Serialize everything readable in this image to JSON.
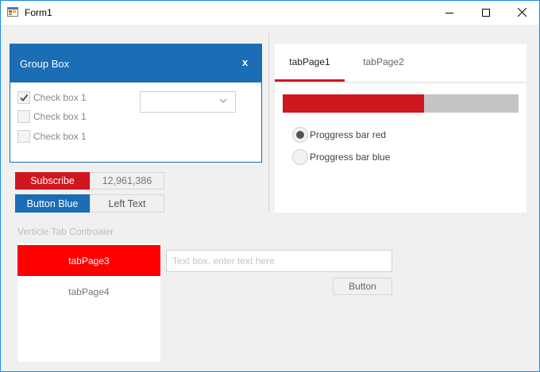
{
  "window": {
    "title": "Form1",
    "icons": {
      "app": "form-app-icon",
      "minimize": "minimize-icon",
      "maximize": "maximize-icon",
      "close": "close-icon"
    }
  },
  "group_box": {
    "title": "Group Box",
    "close_label": "x",
    "checkboxes": [
      {
        "label": "Check box 1",
        "checked": true
      },
      {
        "label": "Check box 1",
        "checked": false
      },
      {
        "label": "Check box 1",
        "checked": false
      }
    ],
    "combo": {
      "value": "",
      "icon": "chevron-down-icon"
    }
  },
  "subscribe": {
    "button_label": "Subscribe",
    "count": "12,961,386"
  },
  "blue_row": {
    "button_label": "Button  Blue",
    "text": "Left Text"
  },
  "tabs": {
    "items": [
      {
        "label": "tabPage1",
        "active": true
      },
      {
        "label": "tabPage2",
        "active": false
      }
    ],
    "progress": {
      "value_fraction": 0.6
    },
    "radios": [
      {
        "label": "Proggress bar red",
        "checked": true
      },
      {
        "label": "Proggress bar blue",
        "checked": false
      }
    ]
  },
  "vertical_tabs": {
    "title": "Verticle Tab Controaler",
    "items": [
      {
        "label": "tabPage3",
        "active": true
      },
      {
        "label": "tabPage4",
        "active": false
      }
    ]
  },
  "textbox": {
    "placeholder": "Text box. enter text here",
    "value": ""
  },
  "button": {
    "label": "Button"
  },
  "colors": {
    "accent_blue": "#1b6db5",
    "accent_red": "#d0161e",
    "active_tab_red": "#ff0000",
    "background": "#f0f0f0"
  }
}
